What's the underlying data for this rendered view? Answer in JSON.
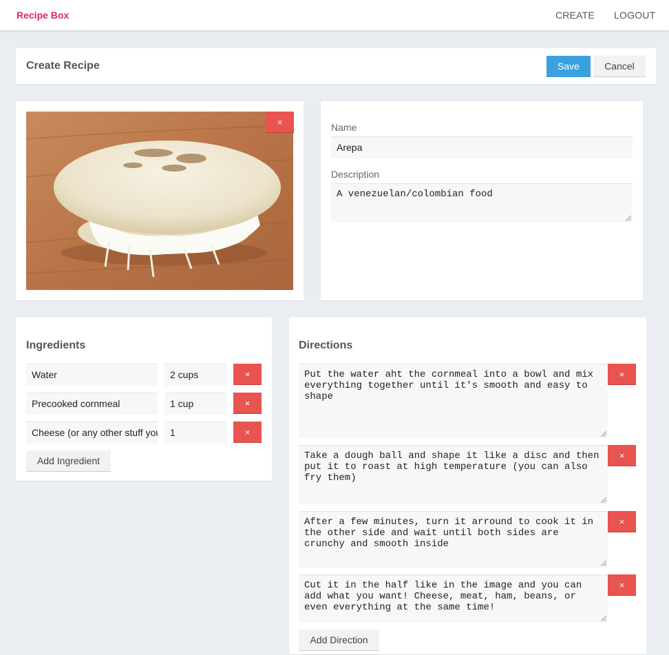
{
  "nav": {
    "brand": "Recipe Box",
    "create_label": "CREATE",
    "logout_label": "LOGOUT"
  },
  "header": {
    "title": "Create Recipe",
    "save_label": "Save",
    "cancel_label": "Cancel"
  },
  "image": {
    "remove_label": "×"
  },
  "details": {
    "name_label": "Name",
    "name_value": "Arepa",
    "description_label": "Description",
    "description_value": "A venezuelan/colombian food"
  },
  "ingredients": {
    "title": "Ingredients",
    "items": [
      {
        "name": "Water",
        "quantity": "2 cups",
        "remove_label": "×"
      },
      {
        "name": "Precooked cornmeal",
        "quantity": "1 cup",
        "remove_label": "×"
      },
      {
        "name": "Cheese (or any other stuff you want)",
        "quantity": "1",
        "remove_label": "×"
      }
    ],
    "add_label": "Add Ingredient"
  },
  "directions": {
    "title": "Directions",
    "items": [
      {
        "text": "Put the water aht the cornmeal into a bowl and mix everything together until it's smooth and easy to shape",
        "remove_label": "×"
      },
      {
        "text": "Take a dough ball and shape it like a disc and then put it to roast at high temperature (you can also fry them)",
        "remove_label": "×"
      },
      {
        "text": "After a few minutes, turn it arround to cook it in the other side and wait until both sides are crunchy and smooth inside",
        "remove_label": "×"
      },
      {
        "text": "Cut it in the half like in the image and you can add what you want! Cheese, meat, ham, beans, or even everything at the same time!",
        "remove_label": "×"
      }
    ],
    "add_label": "Add Direction"
  },
  "colors": {
    "brand": "#e6245e",
    "primary": "#3aa0e0",
    "danger": "#e85450",
    "background": "#eaedf2"
  }
}
